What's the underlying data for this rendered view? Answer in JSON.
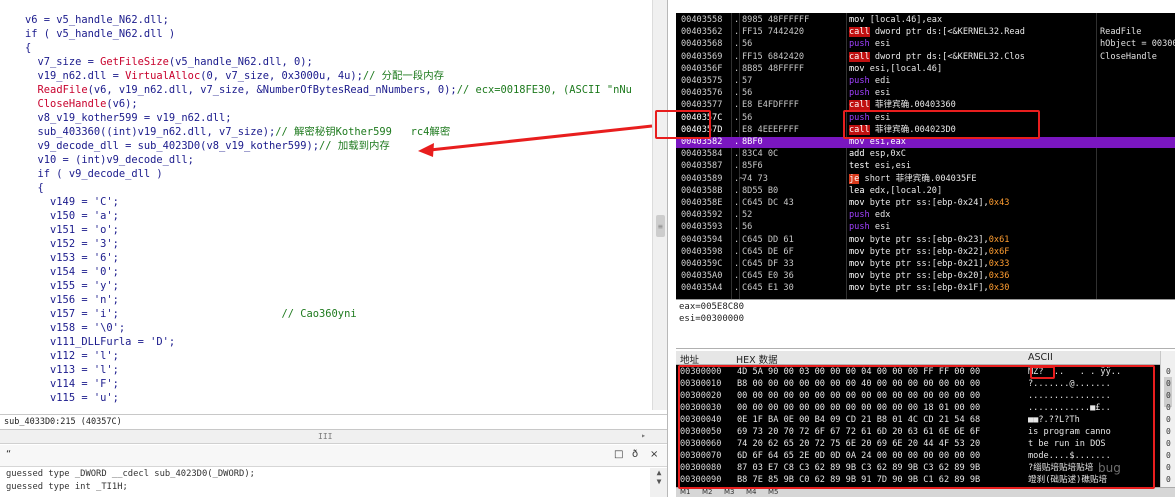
{
  "pseudocode": {
    "lines": [
      [
        {
          "t": "    v6 = v5_handle_N62.dll;",
          "c": "k"
        }
      ],
      [
        {
          "t": "    if ( v5_handle_N62.dll )",
          "c": "k"
        }
      ],
      [
        {
          "t": "    {",
          "c": "k"
        }
      ],
      [
        {
          "t": "      v7_size = ",
          "c": "k"
        },
        {
          "t": "GetFileSize",
          "c": "fn"
        },
        {
          "t": "(v5_handle_N62.dll, 0);",
          "c": "k"
        }
      ],
      [
        {
          "t": "      v19_n62.dll = ",
          "c": "k"
        },
        {
          "t": "VirtualAlloc",
          "c": "fn"
        },
        {
          "t": "(0, v7_size, 0x3000u, 4u);",
          "c": "k"
        },
        {
          "t": "// 分配一段内存",
          "c": "cm"
        }
      ],
      [
        {
          "t": "      ",
          "c": "k"
        },
        {
          "t": "ReadFile",
          "c": "fn"
        },
        {
          "t": "(v6, v19_n62.dll, v7_size, &NumberOfBytesRead_nNumbers, 0);",
          "c": "k"
        },
        {
          "t": "// ecx=0018FE30, (ASCII \"nNu",
          "c": "cm"
        }
      ],
      [
        {
          "t": "      ",
          "c": "k"
        },
        {
          "t": "CloseHandle",
          "c": "fn"
        },
        {
          "t": "(v6);",
          "c": "k"
        }
      ],
      [
        {
          "t": "      v8_v19_kother599 = v19_n62.dll;",
          "c": "k"
        }
      ],
      [
        {
          "t": "      sub_403360((int)v19_n62.dll, v7_size);",
          "c": "k"
        },
        {
          "t": "// 解密秘钥Kother599   rc4解密",
          "c": "cm"
        }
      ],
      [
        {
          "t": "      v9_decode_dll = sub_4023D0(v8_v19_kother599);",
          "c": "k"
        },
        {
          "t": "// 加载到内存",
          "c": "cm"
        }
      ],
      [
        {
          "t": "      v10 = (int)v9_decode_dll;",
          "c": "k"
        }
      ],
      [
        {
          "t": "      if ( v9_decode_dll )",
          "c": "k"
        }
      ],
      [
        {
          "t": "      {",
          "c": "k"
        }
      ],
      [
        {
          "t": "        v149 = 'C';",
          "c": "st"
        }
      ],
      [
        {
          "t": "        v150 = 'a';",
          "c": "st"
        }
      ],
      [
        {
          "t": "        v151 = 'o';",
          "c": "st"
        }
      ],
      [
        {
          "t": "        v152 = '3';",
          "c": "st"
        }
      ],
      [
        {
          "t": "        v153 = '6';",
          "c": "st"
        }
      ],
      [
        {
          "t": "        v154 = '0';",
          "c": "st"
        }
      ],
      [
        {
          "t": "        v155 = 'y';",
          "c": "st"
        }
      ],
      [
        {
          "t": "        v156 = 'n';",
          "c": "st"
        }
      ],
      [
        {
          "t": "        v157 = 'i';",
          "c": "st"
        },
        {
          "t": "                          // Cao360yni",
          "c": "cm"
        }
      ],
      [
        {
          "t": "        v158 = '\\0';",
          "c": "st"
        }
      ],
      [
        {
          "t": "        v111_DLLFurla = 'D';",
          "c": "st"
        }
      ],
      [
        {
          "t": "        v112 = 'l';",
          "c": "st"
        }
      ],
      [
        {
          "t": "        v113 = 'l';",
          "c": "st"
        }
      ],
      [
        {
          "t": "        v114 = 'F';",
          "c": "st"
        }
      ],
      [
        {
          "t": "        v115 = 'u';",
          "c": "st"
        }
      ]
    ],
    "status": "sub_4033D0:215 (40357C)",
    "hscroll_label": "III",
    "output_lines": [
      "guessed type _DWORD __cdecl sub_4023D0(_DWORD);",
      "guessed type int _TI1H;"
    ],
    "output_icons": {
      "restore": "□",
      "pin": "ð",
      "close": "×"
    }
  },
  "disasm": {
    "rows": [
      {
        "a": "00403558",
        "b": ".",
        "h": "8985 48FFFFFF",
        "m": "mov",
        "o": "[local.46],eax",
        "mc": "mov"
      },
      {
        "a": "00403562",
        "b": ".",
        "h": "FF15 7442420",
        "m": "call",
        "o": "dword ptr ds:[<&KERNEL32.Read",
        "mc": "call",
        "x": "ReadFile",
        "xc": "red"
      },
      {
        "a": "00403568",
        "b": ".",
        "h": "56",
        "m": "push",
        "o": "esi",
        "mc": "push",
        "x": "hObject = 00300"
      },
      {
        "a": "00403569",
        "b": ".",
        "h": "FF15 6842420",
        "m": "call",
        "o": "dword ptr ds:[<&KERNEL32.Clos",
        "mc": "call",
        "x": "CloseHandle",
        "xc": "red"
      },
      {
        "a": "0040356F",
        "b": ".",
        "h": "8B85 48FFFFF",
        "m": "mov",
        "o": "esi,[local.46]",
        "mc": "mov"
      },
      {
        "a": "00403575",
        "b": ".",
        "h": "57",
        "m": "push",
        "o": "edi",
        "mc": "push"
      },
      {
        "a": "00403576",
        "b": ".",
        "h": "56",
        "m": "push",
        "o": "esi",
        "mc": "push"
      },
      {
        "a": "00403577",
        "b": ".",
        "h": "E8 E4FDFFFF",
        "m": "call",
        "o": "菲律宾确.00403360",
        "mc": "call"
      },
      {
        "a": "0040357C",
        "b": ".",
        "h": "56",
        "m": "push",
        "o": "esi",
        "mc": "push",
        "tint": true
      },
      {
        "a": "0040357D",
        "b": ".",
        "h": "E8 4EEEFFFF",
        "m": "call",
        "o": "菲律宾确.004023D0",
        "mc": "call",
        "tint": true
      },
      {
        "a": "00403582",
        "b": ".",
        "h": "8BF0",
        "m": "mov",
        "o": "esi,eax",
        "mc": "mov",
        "sel": true
      },
      {
        "a": "00403584",
        "b": ".",
        "h": "83C4 0C",
        "m": "add",
        "o": "esp,0xC",
        "mc": "mov"
      },
      {
        "a": "00403587",
        "b": ".",
        "h": "85F6",
        "m": "test",
        "o": "esi,esi",
        "mc": "mov"
      },
      {
        "a": "00403589",
        "b": ".~",
        "h": "74 73",
        "m": "je",
        "o": "short 菲律宾确.004035FE",
        "mc": "je"
      },
      {
        "a": "0040358B",
        "b": ".",
        "h": "8D55 B0",
        "m": "lea",
        "o": "edx,[local.20]",
        "mc": "mov"
      },
      {
        "a": "0040358E",
        "b": ".",
        "h": "C645 DC 43",
        "m": "mov",
        "o": "byte ptr ss:[ebp-0x24],",
        "mc": "mov",
        "imm": "0x43"
      },
      {
        "a": "00403592",
        "b": ".",
        "h": "52",
        "m": "push",
        "o": "edx",
        "mc": "push"
      },
      {
        "a": "00403593",
        "b": ".",
        "h": "56",
        "m": "push",
        "o": "esi",
        "mc": "push"
      },
      {
        "a": "00403594",
        "b": ".",
        "h": "C645 DD 61",
        "m": "mov",
        "o": "byte ptr ss:[ebp-0x23],",
        "mc": "mov",
        "imm": "0x61"
      },
      {
        "a": "00403598",
        "b": ".",
        "h": "C645 DE 6F",
        "m": "mov",
        "o": "byte ptr ss:[ebp-0x22],",
        "mc": "mov",
        "imm": "0x6F"
      },
      {
        "a": "0040359C",
        "b": ".",
        "h": "C645 DF 33",
        "m": "mov",
        "o": "byte ptr ss:[ebp-0x21],",
        "mc": "mov",
        "imm": "0x33"
      },
      {
        "a": "004035A0",
        "b": ".",
        "h": "C645 E0 36",
        "m": "mov",
        "o": "byte ptr ss:[ebp-0x20],",
        "mc": "mov",
        "imm": "0x36"
      },
      {
        "a": "004035A4",
        "b": ".",
        "h": "C645 E1 30",
        "m": "mov",
        "o": "byte ptr ss:[ebp-0x1F],",
        "mc": "mov",
        "imm": "0x30"
      }
    ]
  },
  "registers": [
    "eax=005E8C80",
    "esi=00300000"
  ],
  "dump": {
    "col_address": "地址",
    "col_hex": "HEX 数据",
    "col_ascii": "ASCII",
    "rows": [
      {
        "a": "00300000",
        "x": "4D 5A 90 00 03 00 00 00 04 00 00 00 FF FF 00 00",
        "t": "MZ?  ..   . . ÿÿ.."
      },
      {
        "a": "00300010",
        "x": "B8 00 00 00 00 00 00 00 40 00 00 00 00 00 00 00",
        "t": "?.......@......."
      },
      {
        "a": "00300020",
        "x": "00 00 00 00 00 00 00 00 00 00 00 00 00 00 00 00",
        "t": "................"
      },
      {
        "a": "00300030",
        "x": "00 00 00 00 00 00 00 00 00 00 00 00 18 01 00 00",
        "t": "............■£.."
      },
      {
        "a": "00300040",
        "x": "0E 1F BA 0E 00 B4 09 CD 21 B8 01 4C CD 21 54 68",
        "t": "■■?.??L?Th"
      },
      {
        "a": "00300050",
        "x": "69 73 20 70 72 6F 67 72 61 6D 20 63 61 6E 6E 6F",
        "t": "is program canno"
      },
      {
        "a": "00300060",
        "x": "74 20 62 65 20 72 75 6E 20 69 6E 20 44 4F 53 20",
        "t": "t be run in DOS "
      },
      {
        "a": "00300070",
        "x": "6D 6F 64 65 2E 0D 0D 0A 24 00 00 00 00 00 00 00",
        "t": "mode....$......."
      },
      {
        "a": "00300080",
        "x": "87 03 E7 C8 C3 62 89 9B C3 62 89 9B C3 62 89 9B",
        "t": "?缁贴培贴培贴培"
      },
      {
        "a": "00300090",
        "x": "B8 7E 85 9B C0 62 89 9B 91 7D 90 9B C1 62 89 9B",
        "t": "竳刹(础贴逑)礁贴培"
      }
    ],
    "side_zeros": [
      "0",
      "0",
      "0",
      "0",
      "0",
      "0",
      "0",
      "0",
      "0",
      "0"
    ]
  },
  "bottom_tabs": [
    "M1",
    "M2",
    "M3",
    "M4",
    "M5"
  ],
  "watermark": "bug"
}
